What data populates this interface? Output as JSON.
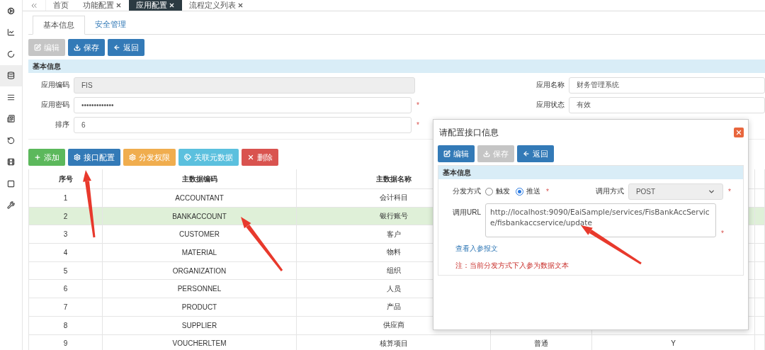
{
  "sidebar": {
    "items": [
      {
        "selected": false
      },
      {
        "selected": false
      },
      {
        "selected": false
      },
      {
        "selected": true
      },
      {
        "selected": false
      },
      {
        "selected": false
      },
      {
        "selected": false
      },
      {
        "selected": false
      },
      {
        "selected": false
      },
      {
        "selected": false
      }
    ]
  },
  "tabs": [
    {
      "label": "首页",
      "closable": false,
      "selected": false
    },
    {
      "label": "功能配置",
      "closable": true,
      "selected": false
    },
    {
      "label": "应用配置",
      "closable": true,
      "selected": true
    },
    {
      "label": "流程定义列表",
      "closable": true,
      "selected": false
    }
  ],
  "subtabs": [
    {
      "label": "基本信息",
      "selected": true
    },
    {
      "label": "安全管理",
      "selected": false
    }
  ],
  "toolbar": [
    {
      "label": "编辑",
      "disabled": true
    },
    {
      "label": "保存",
      "disabled": false
    },
    {
      "label": "返回",
      "disabled": false
    }
  ],
  "panel": {
    "title": "基本信息",
    "left_fields": [
      {
        "label": "应用编码",
        "value": "FIS",
        "disabled": true
      },
      {
        "label": "应用密码",
        "value": "•••••••••••••",
        "disabled": false,
        "mark": "*"
      },
      {
        "label": "排序",
        "value": "6",
        "disabled": false,
        "mark": "*"
      }
    ],
    "right_fields": [
      {
        "label": "应用名称",
        "value": "财务管理系统"
      },
      {
        "label": "应用状态",
        "value": "有效"
      }
    ]
  },
  "actions": [
    {
      "label": "添加"
    },
    {
      "label": "接口配置"
    },
    {
      "label": "分发权限"
    },
    {
      "label": "关联元数据"
    },
    {
      "label": "删除"
    }
  ],
  "table": {
    "columns": [
      "序号",
      "主数据编码",
      "主数据名称"
    ],
    "rows": [
      {
        "cells": [
          "1",
          "ACCOUNTANT",
          "会计科目"
        ],
        "selected": false
      },
      {
        "cells": [
          "2",
          "BANKACCOUNT",
          "银行账号"
        ],
        "selected": true
      },
      {
        "cells": [
          "3",
          "CUSTOMER",
          "客户"
        ],
        "selected": false
      },
      {
        "cells": [
          "4",
          "MATERIAL",
          "物料"
        ],
        "selected": false
      },
      {
        "cells": [
          "5",
          "ORGANIZATION",
          "组织"
        ],
        "selected": false
      },
      {
        "cells": [
          "6",
          "PERSONNEL",
          "人员"
        ],
        "selected": false
      },
      {
        "cells": [
          "7",
          "PRODUCT",
          "产品"
        ],
        "selected": false
      },
      {
        "cells": [
          "8",
          "SUPPLIER",
          "供应商"
        ],
        "selected": false
      },
      {
        "cells": [
          "9",
          "VOUCHERLTEM",
          "核算项目",
          "普通",
          "Y"
        ],
        "selected": false
      }
    ]
  },
  "dialog": {
    "title": "请配置接口信息",
    "buttons": [
      {
        "label": "编辑",
        "disabled": false
      },
      {
        "label": "保存",
        "disabled": true
      },
      {
        "label": "返回",
        "disabled": false
      }
    ],
    "section": "基本信息",
    "dispatch": {
      "label": "分发方式",
      "options": [
        {
          "label": "触发",
          "selected": false
        },
        {
          "label": "推送",
          "selected": true
        }
      ],
      "mark": "*"
    },
    "method": {
      "label": "调用方式",
      "value": "POST",
      "mark": "*"
    },
    "url": {
      "label": "调用URL",
      "value": "http://localhost:9090/EaiSample/services/FisBankAccService/fisbankaccservice/update",
      "mark": "*"
    },
    "link": "查看入参报文",
    "note": "注：当前分发方式下入参为数据文本"
  }
}
